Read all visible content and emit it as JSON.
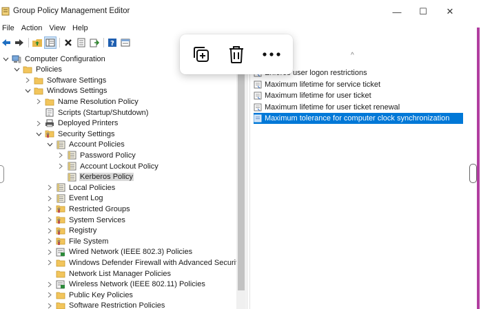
{
  "window": {
    "title": "Group Policy Management Editor",
    "controls": {
      "minimize": "—",
      "maximize": "☐",
      "close": "✕"
    }
  },
  "menu": [
    "File",
    "Action",
    "View",
    "Help"
  ],
  "toolbar": {
    "icons": [
      "back-arrow-icon",
      "forward-arrow-icon",
      "up-folder-icon",
      "show-tree-icon",
      "delete-icon",
      "properties-icon",
      "export-icon",
      "help-icon",
      "view-icon"
    ]
  },
  "popup": {
    "icons": [
      "copy-add-icon",
      "trash-icon",
      "more-icon"
    ]
  },
  "tree": [
    {
      "label": "Computer Configuration",
      "level": 0,
      "state": "open",
      "icon": "computer-icon"
    },
    {
      "label": "Policies",
      "level": 1,
      "state": "open",
      "icon": "folder-icon"
    },
    {
      "label": "Software Settings",
      "level": 2,
      "state": "closed",
      "icon": "folder-icon"
    },
    {
      "label": "Windows Settings",
      "level": 2,
      "state": "open",
      "icon": "folder-icon"
    },
    {
      "label": "Name Resolution Policy",
      "level": 3,
      "state": "closed",
      "icon": "folder-icon"
    },
    {
      "label": "Scripts (Startup/Shutdown)",
      "level": 3,
      "state": "none",
      "icon": "script-icon"
    },
    {
      "label": "Deployed Printers",
      "level": 3,
      "state": "closed",
      "icon": "printer-icon"
    },
    {
      "label": "Security Settings",
      "level": 3,
      "state": "open",
      "icon": "security-folder-icon"
    },
    {
      "label": "Account Policies",
      "level": 4,
      "state": "open",
      "icon": "policy-icon"
    },
    {
      "label": "Password Policy",
      "level": 5,
      "state": "closed",
      "icon": "policy-icon"
    },
    {
      "label": "Account Lockout Policy",
      "level": 5,
      "state": "closed",
      "icon": "policy-icon"
    },
    {
      "label": "Kerberos Policy",
      "level": 5,
      "state": "none",
      "icon": "policy-icon",
      "selected": true
    },
    {
      "label": "Local Policies",
      "level": 4,
      "state": "closed",
      "icon": "policy-icon"
    },
    {
      "label": "Event Log",
      "level": 4,
      "state": "closed",
      "icon": "policy-icon"
    },
    {
      "label": "Restricted Groups",
      "level": 4,
      "state": "closed",
      "icon": "security-folder-icon"
    },
    {
      "label": "System Services",
      "level": 4,
      "state": "closed",
      "icon": "security-folder-icon"
    },
    {
      "label": "Registry",
      "level": 4,
      "state": "closed",
      "icon": "security-folder-icon"
    },
    {
      "label": "File System",
      "level": 4,
      "state": "closed",
      "icon": "security-folder-icon"
    },
    {
      "label": "Wired Network (IEEE 802.3) Policies",
      "level": 4,
      "state": "closed",
      "icon": "network-policy-icon"
    },
    {
      "label": "Windows Defender Firewall with Advanced Security",
      "level": 4,
      "state": "closed",
      "icon": "folder-icon"
    },
    {
      "label": "Network List Manager Policies",
      "level": 4,
      "state": "none",
      "icon": "folder-icon"
    },
    {
      "label": "Wireless Network (IEEE 802.11) Policies",
      "level": 4,
      "state": "closed",
      "icon": "network-policy-icon"
    },
    {
      "label": "Public Key Policies",
      "level": 4,
      "state": "closed",
      "icon": "folder-icon"
    },
    {
      "label": "Software Restriction Policies",
      "level": 4,
      "state": "closed",
      "icon": "folder-icon"
    }
  ],
  "list": {
    "rows": [
      {
        "label": "Enforce user logon restrictions",
        "selected": false
      },
      {
        "label": "Maximum lifetime for service ticket",
        "selected": false
      },
      {
        "label": "Maximum lifetime for user ticket",
        "selected": false
      },
      {
        "label": "Maximum lifetime for user ticket renewal",
        "selected": false
      },
      {
        "label": "Maximum tolerance for computer clock synchronization",
        "selected": true
      }
    ]
  },
  "colors": {
    "selection": "#0078d7",
    "tree_selection": "#d9d9d9",
    "folder": "#e8b84a",
    "accent_strip": "#b13ea0"
  }
}
